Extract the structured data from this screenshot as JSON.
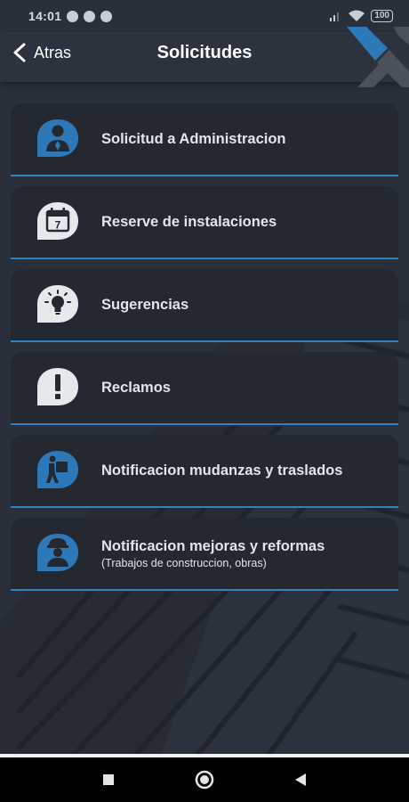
{
  "status_bar": {
    "time": "14:01",
    "battery": "100"
  },
  "header": {
    "back_label": "Atras",
    "title": "Solicitudes"
  },
  "items": [
    {
      "label": "Solicitud a Administracion",
      "subtitle": "",
      "icon": "admin-person-icon",
      "icon_bg": "#2e78b8"
    },
    {
      "label": "Reserve de instalaciones",
      "subtitle": "",
      "icon": "calendar-icon",
      "icon_bg": "#e6e8ec"
    },
    {
      "label": "Sugerencias",
      "subtitle": "",
      "icon": "lightbulb-icon",
      "icon_bg": "#e6e8ec"
    },
    {
      "label": "Reclamos",
      "subtitle": "",
      "icon": "exclamation-icon",
      "icon_bg": "#e6e8ec"
    },
    {
      "label": "Notificacion mudanzas y traslados",
      "subtitle": "",
      "icon": "moving-person-icon",
      "icon_bg": "#2e78b8"
    },
    {
      "label": "Notificacion mejoras y reformas",
      "subtitle": "(Trabajos de construccion, obras)",
      "icon": "construction-worker-icon",
      "icon_bg": "#2e78b8"
    }
  ],
  "colors": {
    "background": "#2a303b",
    "card": "#232831",
    "accent": "#2f82c1"
  }
}
